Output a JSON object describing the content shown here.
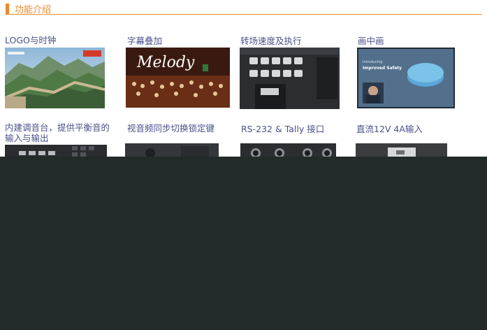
{
  "section": {
    "title": "功能介绍"
  },
  "features": {
    "logo_clock": "LOGO与时钟",
    "subtitle_overlay": "字幕叠加",
    "transition_speed": "转场速度及执行",
    "pip": "画中画",
    "audio_mixer_line1": "内建调音台，提供平衡音的",
    "audio_mixer_line2": "输入与输出",
    "av_sync": "视音频同步切换锁定键",
    "rs232_tally": "RS-232 & Tally 接口",
    "dc_input": "直流12V 4A输入"
  },
  "thumbnails": {
    "melody_text": "Melody",
    "pip_text_small": "Introducing",
    "pip_text_title": "Improved Safety"
  },
  "colors": {
    "accent": "#e98a2e",
    "label_text": "#4a4f8a",
    "overlay": "#232a2a"
  }
}
